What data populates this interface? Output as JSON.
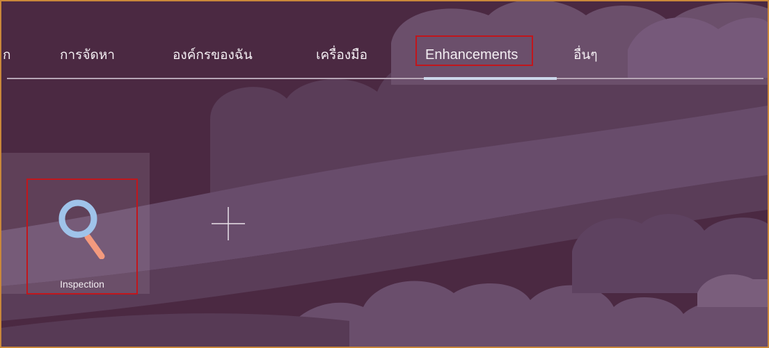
{
  "nav": {
    "items": [
      {
        "label": "ก",
        "partial": true
      },
      {
        "label": "การจัดหา"
      },
      {
        "label": "องค์กรของฉัน"
      },
      {
        "label": "เครื่องมือ"
      },
      {
        "label": "Enhancements",
        "active": true
      },
      {
        "label": "อื่นๆ"
      }
    ]
  },
  "tiles": [
    {
      "label": "Inspection",
      "icon": "search-icon"
    }
  ],
  "add_tile": {
    "icon": "plus-icon"
  },
  "colors": {
    "background": "#4d2b44",
    "cloud": "#6d5370",
    "highlight_border": "#c1161c",
    "active_tab_bar": "#cbd7ea",
    "magnifier_ring": "#9fc3ea",
    "magnifier_handle": "#f39a7e"
  }
}
